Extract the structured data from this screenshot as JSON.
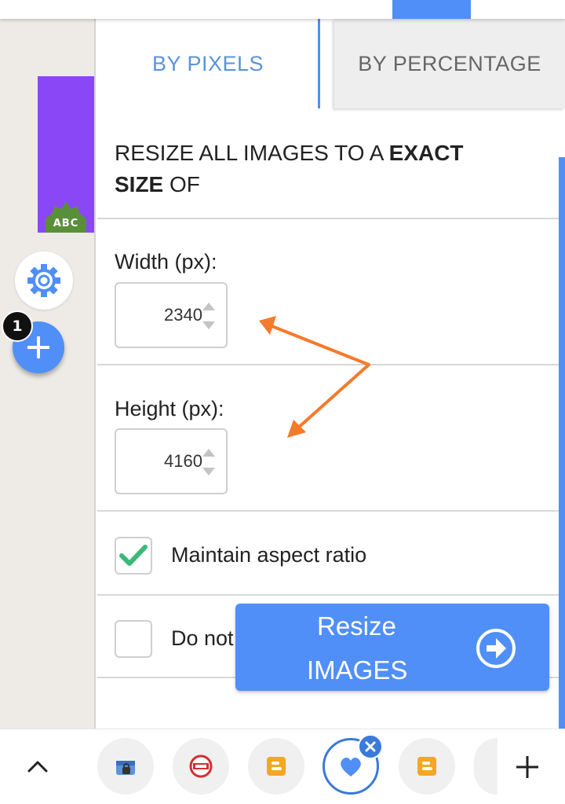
{
  "tabs": {
    "pixels": "BY PIXELS",
    "percentage": "BY PERCENTAGE"
  },
  "section_title": {
    "prefix": "RESIZE ALL IMAGES TO A ",
    "bold1": "EXACT",
    "bold2": "SIZE",
    "suffix": " OF"
  },
  "width": {
    "label": "Width (px):",
    "value": "2340"
  },
  "height": {
    "label": "Height (px):",
    "value": "4160"
  },
  "options": {
    "maintain_aspect": {
      "label": "Maintain aspect ratio",
      "checked": true
    },
    "second_option": {
      "label": "Do not",
      "checked": false
    }
  },
  "resize_button": {
    "line1": "Resize",
    "line2": "IMAGES"
  },
  "sidebar": {
    "thumbnail_badge": "ABC",
    "count_badge": "1"
  },
  "colors": {
    "accent": "#4f8ff7",
    "arrow": "#f57a2a",
    "check": "#3cb878",
    "thumbnail": "#8a47f5"
  },
  "bottom_bar": {
    "icons": [
      "chevron-up-icon",
      "store-lock-icon",
      "red-app-icon",
      "blogger-icon",
      "heart-app-icon",
      "blogger-icon",
      "partial-app-icon",
      "plus-icon"
    ]
  }
}
